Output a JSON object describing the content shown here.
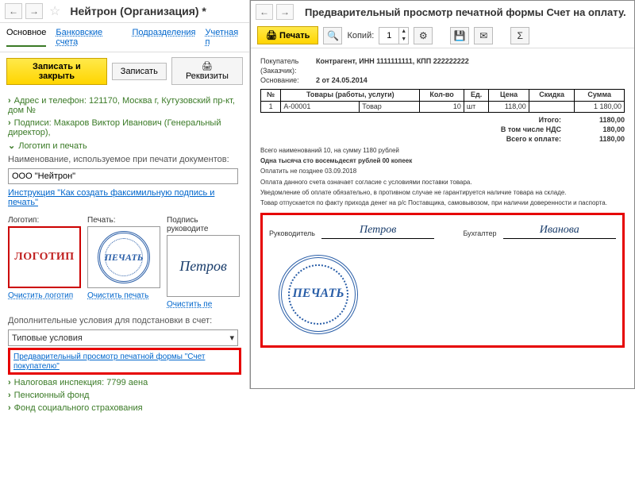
{
  "left": {
    "title": "Нейтрон (Организация) *",
    "tabs": {
      "main": "Основное",
      "bank": "Банковские счета",
      "dept": "Подразделения",
      "acct": "Учетная п"
    },
    "save_close": "Записать и закрыть",
    "save": "Записать",
    "details_btn": "Реквизиты",
    "address": "Адрес и телефон: 121170, Москва г, Кутузовский пр-кт, дом №",
    "signatures": "Подписи: Макаров Виктор Иванович (Генеральный директор),",
    "logo_section": "Логотип и печать",
    "name_label": "Наименование, используемое при печати документов:",
    "name_value": "ООО \"Нейтрон\"",
    "instruction_link": "Инструкция \"Как создать факсимильную подпись и печать\"",
    "col": {
      "logo": "Логотип:",
      "stamp": "Печать:",
      "sig": "Подпись руководите"
    },
    "logo_text": "ЛОГОТИП",
    "stamp_text": "ПЕЧАТЬ",
    "sig_text": "Петров",
    "clear": {
      "logo": "Очистить логотип",
      "stamp": "Очистить печать",
      "sig": "Очистить пе"
    },
    "extra_label": "Дополнительные условия для подстановки в счет:",
    "dropdown_val": "Типовые условия",
    "preview_link": "Предварительный просмотр печатной формы \"Счет покупателю\"",
    "tax": "Налоговая инспекция: 7799 аена",
    "pension": "Пенсионный фонд",
    "fss": "Фонд социального страхования"
  },
  "right": {
    "title": "Предварительный просмотр печатной формы Счет на оплату.",
    "print_btn": "Печать",
    "copies_lbl": "Копий:",
    "copies_val": "1",
    "buyer_lbl": "Покупатель (Заказчик):",
    "buyer_val": "Контрагент, ИНН 1111111111, КПП 222222222",
    "basis_lbl": "Основание:",
    "basis_val": "2 от 24.05.2014",
    "th": {
      "n": "№",
      "goods": "Товары (работы, услуги)",
      "qty": "Кол-во",
      "unit": "Ед.",
      "price": "Цена",
      "disc": "Скидка",
      "sum": "Сумма"
    },
    "row": {
      "n": "1",
      "code": "А-00001",
      "name": "Товар",
      "qty": "10",
      "unit": "шт",
      "price": "118,00",
      "sum": "1 180,00"
    },
    "totals": {
      "itogo_l": "Итого:",
      "itogo_v": "1180,00",
      "nds_l": "В том числе НДС",
      "nds_v": "180,00",
      "pay_l": "Всего к оплате:",
      "pay_v": "1180,00"
    },
    "summary1": "Всего наименований 10, на сумму 1180 рублей",
    "summary2": "Одна тысяча сто восемьдесят рублей 00 копеек",
    "terms1": "Оплатить не позднее 03.09.2018",
    "terms2": "Оплата данного счета означает согласие с условиями поставки товара.",
    "terms3": "Уведомление об оплате обязательно, в противном случае не гарантируется наличие товара на складе.",
    "terms4": "Товар отпускается по факту прихода денег на р/с Поставщика, самовывозом, при наличии доверенности и паспорта.",
    "role1": "Руководитель",
    "sig1": "Петров",
    "role2": "Бухгалтер",
    "sig2": "Иванова",
    "stamp_text": "ПЕЧАТЬ"
  }
}
